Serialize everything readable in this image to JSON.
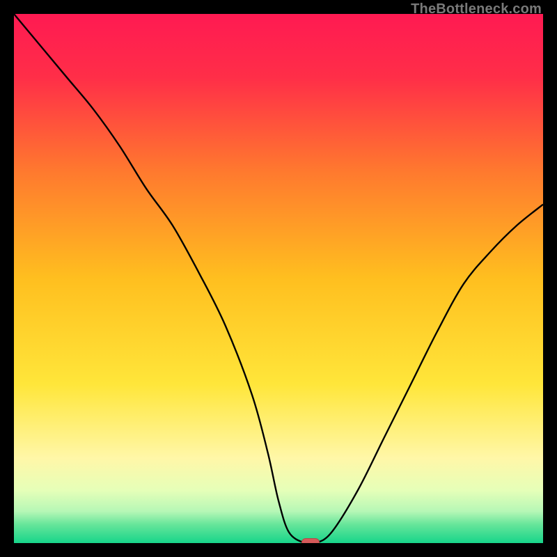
{
  "attribution": "TheBottleneck.com",
  "colors": {
    "frame": "#000000",
    "gradient_stops": [
      {
        "offset": 0,
        "color": "#ff1a52"
      },
      {
        "offset": 0.12,
        "color": "#ff2e48"
      },
      {
        "offset": 0.3,
        "color": "#ff7a2e"
      },
      {
        "offset": 0.5,
        "color": "#ffbf1f"
      },
      {
        "offset": 0.7,
        "color": "#ffe63a"
      },
      {
        "offset": 0.84,
        "color": "#fff7a8"
      },
      {
        "offset": 0.9,
        "color": "#e6ffb8"
      },
      {
        "offset": 0.94,
        "color": "#b6f7b6"
      },
      {
        "offset": 0.965,
        "color": "#66e59a"
      },
      {
        "offset": 1.0,
        "color": "#17d58a"
      }
    ],
    "curve": "#000000",
    "marker_fill": "#d65a5a",
    "marker_stroke": "#b74545"
  },
  "chart_data": {
    "type": "line",
    "title": "",
    "xlabel": "",
    "ylabel": "",
    "xlim": [
      0,
      100
    ],
    "ylim": [
      0,
      100
    ],
    "series": [
      {
        "name": "bottleneck-curve",
        "x": [
          0,
          5,
          10,
          15,
          20,
          25,
          30,
          35,
          40,
          45,
          48,
          50,
          52,
          55,
          57,
          60,
          65,
          70,
          75,
          80,
          85,
          90,
          95,
          100
        ],
        "y": [
          100,
          94,
          88,
          82,
          75,
          67,
          60,
          51,
          41,
          28,
          17,
          8,
          2,
          0,
          0,
          2,
          10,
          20,
          30,
          40,
          49,
          55,
          60,
          64
        ]
      }
    ],
    "flat_segment": {
      "x_start": 52,
      "x_end": 58,
      "y": 0
    },
    "marker": {
      "x": 56,
      "y": 0
    }
  }
}
